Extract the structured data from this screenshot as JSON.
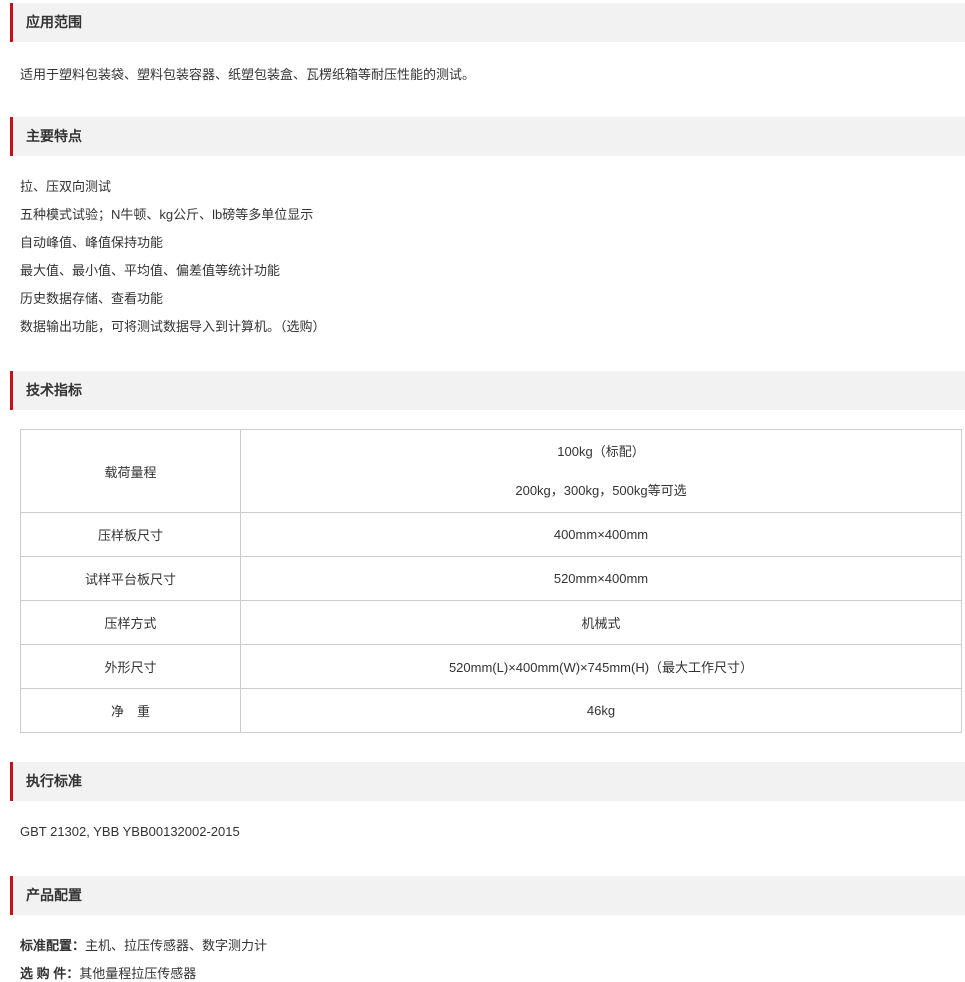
{
  "sections": {
    "application": {
      "title": "应用范围",
      "text": "适用于塑料包装袋、塑料包装容器、纸塑包装盒、瓦楞纸箱等耐压性能的测试。"
    },
    "features": {
      "title": "主要特点",
      "items": [
        "拉、压双向测试",
        "五种模式试验；N牛顿、kg公斤、lb磅等多单位显示",
        "自动峰值、峰值保持功能",
        "最大值、最小值、平均值、偏差值等统计功能",
        "历史数据存储、查看功能",
        "数据输出功能，可将测试数据导入到计算机。（选购）"
      ]
    },
    "specs": {
      "title": "技术指标",
      "rows": [
        {
          "key": "载荷量程",
          "value_line1": "100kg（标配）",
          "value_line2": "200kg，300kg，500kg等可选"
        },
        {
          "key": "压样板尺寸",
          "value": "400mm×400mm"
        },
        {
          "key": "试样平台板尺寸",
          "value": "520mm×400mm"
        },
        {
          "key": "压样方式",
          "value": "机械式"
        },
        {
          "key": "外形尺寸",
          "value": "520mm(L)×400mm(W)×745mm(H)（最大工作尺寸）"
        },
        {
          "key": "净　重",
          "value": "46kg"
        }
      ]
    },
    "standards": {
      "title": "执行标准",
      "text": "GBT 21302, YBB YBB00132002-2015"
    },
    "config": {
      "title": "产品配置",
      "standard_label": "标准配置：",
      "standard_value": "主机、拉压传感器、数字测力计",
      "optional_label": "选 购 件：",
      "optional_value": "其他量程拉压传感器"
    }
  },
  "colors": {
    "accent": "#c4121b",
    "header_bg": "#f2f2f2",
    "border": "#cccccc",
    "text": "#333333"
  }
}
